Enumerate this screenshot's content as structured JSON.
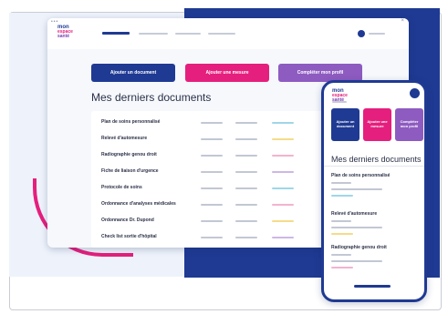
{
  "brand": {
    "line1": "mon",
    "line2": "espace",
    "line3": "santé"
  },
  "window": {
    "dots": "•••",
    "close": "×"
  },
  "actions": {
    "add_document": "Ajouter un document",
    "add_measure": "Ajouter une mesure",
    "complete_profile": "Compléter mon profil"
  },
  "section_title": "Mes derniers documents",
  "documents": [
    "Plan de soins personnalisé",
    "Relevé d'automesure",
    "Radiographie genou droit",
    "Fiche de liaison d'urgence",
    "Protocole de soins",
    "Ordonnance d'analyses médicales",
    "Ordonnance Dr. Dupond",
    "Check list sortie d'hôpital"
  ],
  "mobile": {
    "actions": {
      "add_document": "Ajouter un document",
      "add_measure": "Ajouter une mesure",
      "complete_profile": "Compléter mon profil"
    },
    "section_title": "Mes derniers documents",
    "documents": [
      "Plan de soins personnalisé",
      "Relevé d'automesure",
      "Radiographie genou droit"
    ]
  },
  "colors": {
    "navy": "#1f3a93",
    "pink": "#e51f7d",
    "purple": "#8e5bc1",
    "accent_cyan": "#9fd6e8",
    "accent_yellow": "#f5dc8a",
    "accent_pink": "#f3b3cf",
    "accent_lilac": "#cdb7e6"
  }
}
